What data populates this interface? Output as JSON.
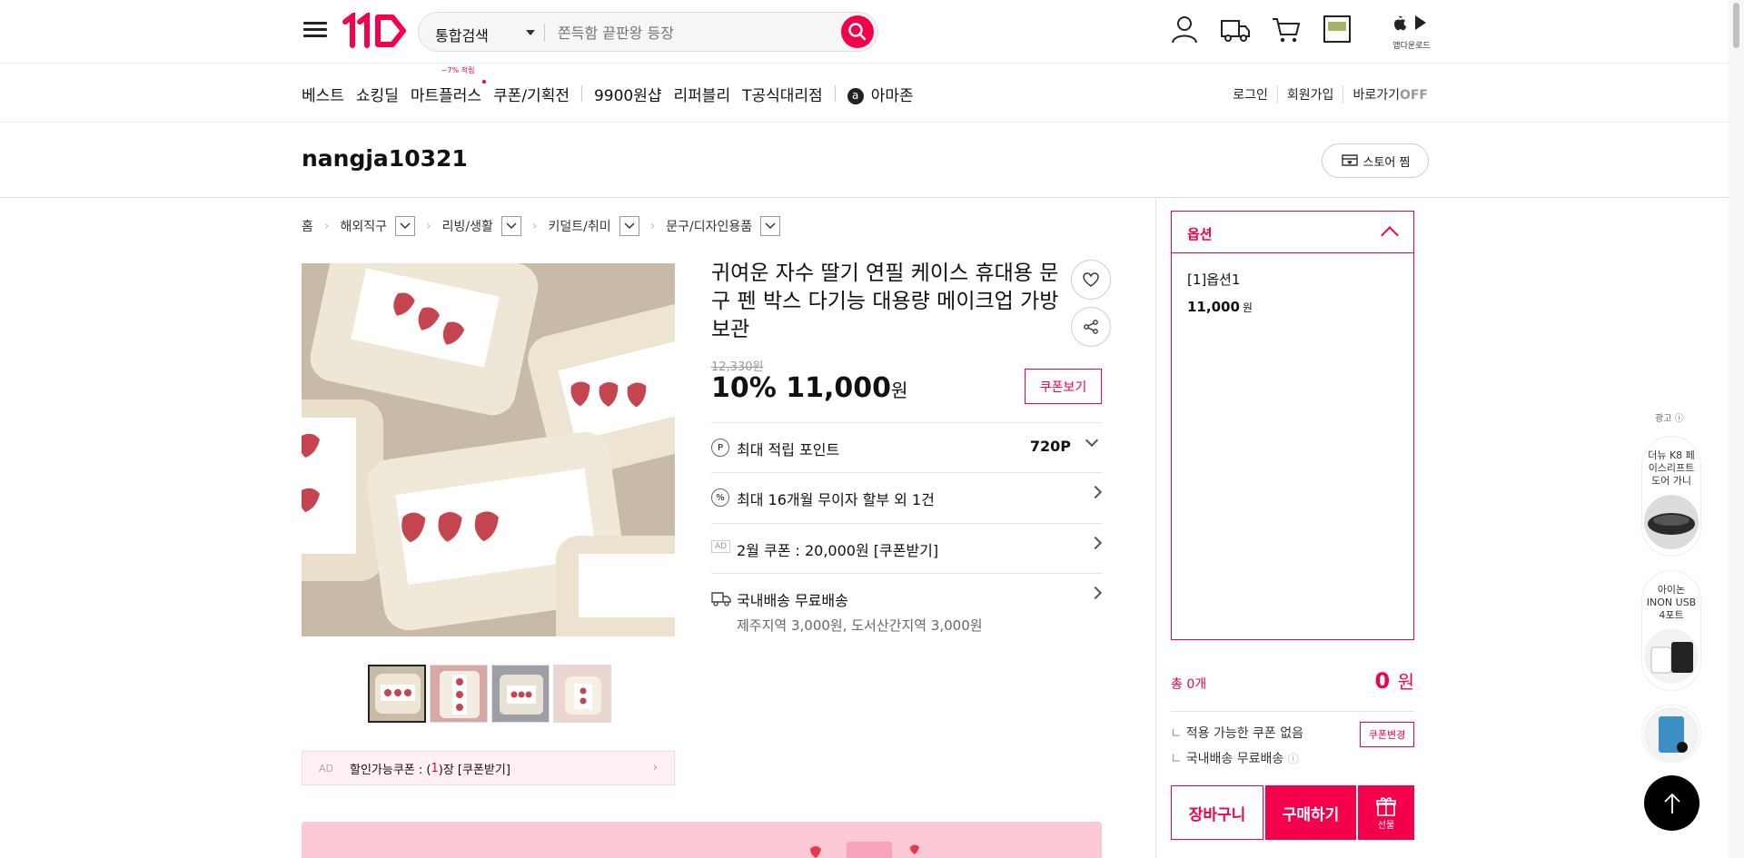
{
  "header": {
    "search_scope": "통합검색",
    "search_placeholder": "쫀득함 끝판왕 등장",
    "app_download": "앱다운로드"
  },
  "nav": {
    "items": [
      "베스트",
      "쇼킹딜",
      "마트플러스",
      "쿠폰/기획전",
      "9900원샵",
      "리퍼블리",
      "T공식대리점",
      "아마존"
    ],
    "mart_badge": "~7% 적립",
    "amazon_glyph": "a"
  },
  "utils": {
    "login": "로그인",
    "signup": "회원가입",
    "shortcut": "바로가기",
    "shortcut_state": "OFF"
  },
  "store": {
    "name": "nangja10321",
    "follow_label": "스토어 찜"
  },
  "breadcrumb": [
    "홈",
    "해외직구",
    "리빙/생활",
    "키덜트/취미",
    "문구/디자인용품"
  ],
  "product": {
    "title": "귀여운 자수 딸기 연필 케이스 휴대용 문구 펜 박스 다기능 대용량 메이크업 가방 보관",
    "original_price": "12,330원",
    "discount": "10%",
    "price": "11,000",
    "price_unit": "원",
    "coupon_view": "쿠폰보기",
    "points_label": "최대 적립 포인트",
    "points_value": "720P",
    "points_icon": "P",
    "installment": "최대 16개월 무이자 할부 외 1건",
    "installment_icon": "%",
    "ad_tag": "AD",
    "coupon_row": "2월 쿠폰 : 20,000원 [쿠폰받기]",
    "shipping": "국내배송 무료배송",
    "shipping_sub": "제주지역 3,000원, 도서산간지역 3,000원",
    "ad_coupon_tag": "AD",
    "ad_coupon_prefix": "할인가능쿠폰 : (",
    "ad_coupon_count": "1",
    "ad_coupon_suffix": ")장 [쿠폰받기]"
  },
  "sidebar": {
    "option_title": "옵션",
    "option_name": "[1]옵션1",
    "option_price": "11,000",
    "option_unit": "원",
    "total_label": "총 0개",
    "total_value": "0",
    "total_unit": "원",
    "no_coupon": "적용 가능한 쿠폰 없음",
    "coupon_change": "쿠폰변경",
    "ship_free": "국내배송 무료배송",
    "cart": "장바구니",
    "buy": "구매하기",
    "gift": "선물"
  },
  "ads": {
    "label": "광고",
    "card1": "더뉴 K8 페이스리프트 도어 가니",
    "card2": "아이논 INON USB 4포트"
  },
  "colors": {
    "brand": "#f5004a"
  }
}
